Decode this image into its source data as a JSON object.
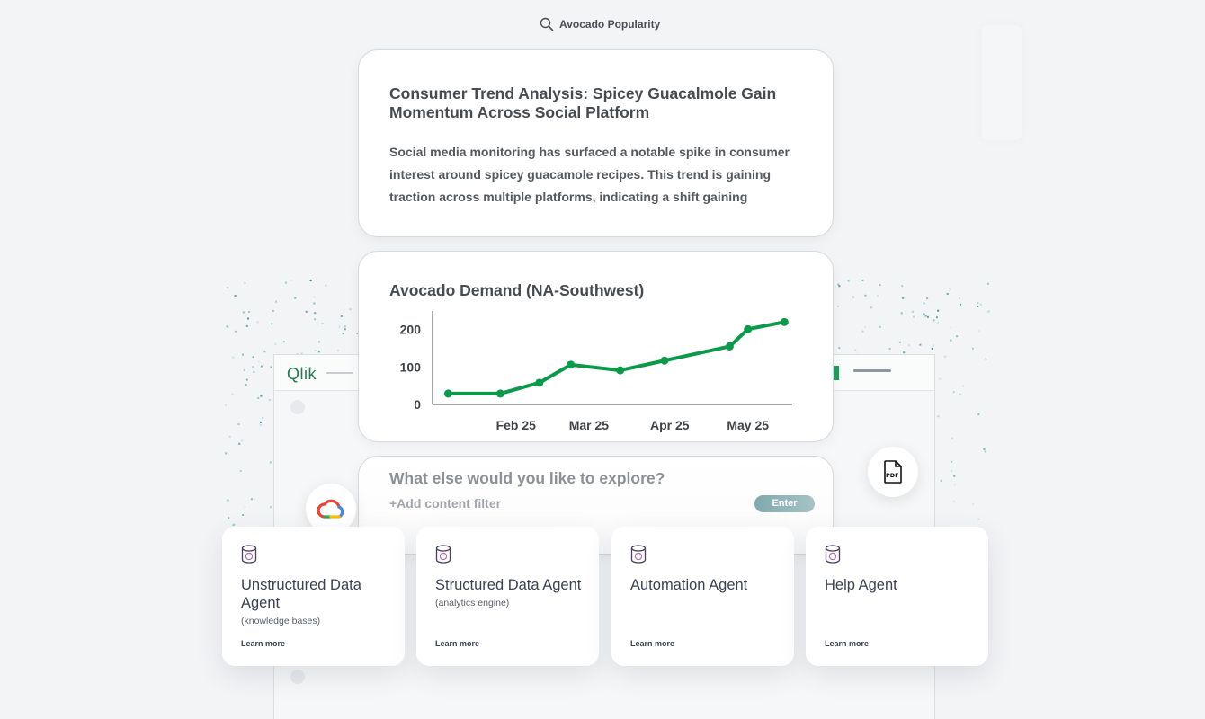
{
  "search": {
    "label": "Avocado Popularity",
    "icon": "search-icon"
  },
  "background_app": {
    "logo": "Qlik"
  },
  "article": {
    "title": "Consumer Trend Analysis: Spicey Guacalmole Gain Momentum Across Social Platform",
    "body": "Social media monitoring has surfaced a notable spike in consumer interest around spicey guacamole recipes. This trend is gaining traction across multiple platforms, indicating a shift gaining"
  },
  "chart_data": {
    "type": "line",
    "title": "Avocado Demand (NA-Southwest)",
    "xlabel": "",
    "ylabel": "",
    "x_tick_labels": [
      "Feb 25",
      "Mar 25",
      "Apr 25",
      "May 25"
    ],
    "y_tick_labels": [
      "0",
      "100",
      "200"
    ],
    "ylim": [
      0,
      240
    ],
    "grid": false,
    "series": [
      {
        "color": "#0a9a4a",
        "x": [
          "2025-01-20",
          "2025-02-09",
          "2025-02-24",
          "2025-03-08",
          "2025-03-27",
          "2025-04-13",
          "2025-05-08",
          "2025-05-15",
          "2025-05-29"
        ],
        "values": [
          29,
          29,
          58,
          106,
          91,
          117,
          155,
          201,
          220
        ]
      }
    ]
  },
  "explore": {
    "prompt": "What else would you like to explore?",
    "filter": "+Add content filter",
    "enter_label": "Enter"
  },
  "badges": {
    "cloud": "google-cloud-icon",
    "pdf_label": "PDF"
  },
  "agents": [
    {
      "name": "Unstructured Data Agent",
      "subtitle": "(knowledge bases)",
      "link": "Learn more"
    },
    {
      "name": "Structured Data Agent",
      "subtitle": "(analytics engine)",
      "link": "Learn more"
    },
    {
      "name": "Automation Agent",
      "subtitle": "",
      "link": "Learn more"
    },
    {
      "name": "Help Agent",
      "subtitle": "",
      "link": "Learn more"
    }
  ]
}
